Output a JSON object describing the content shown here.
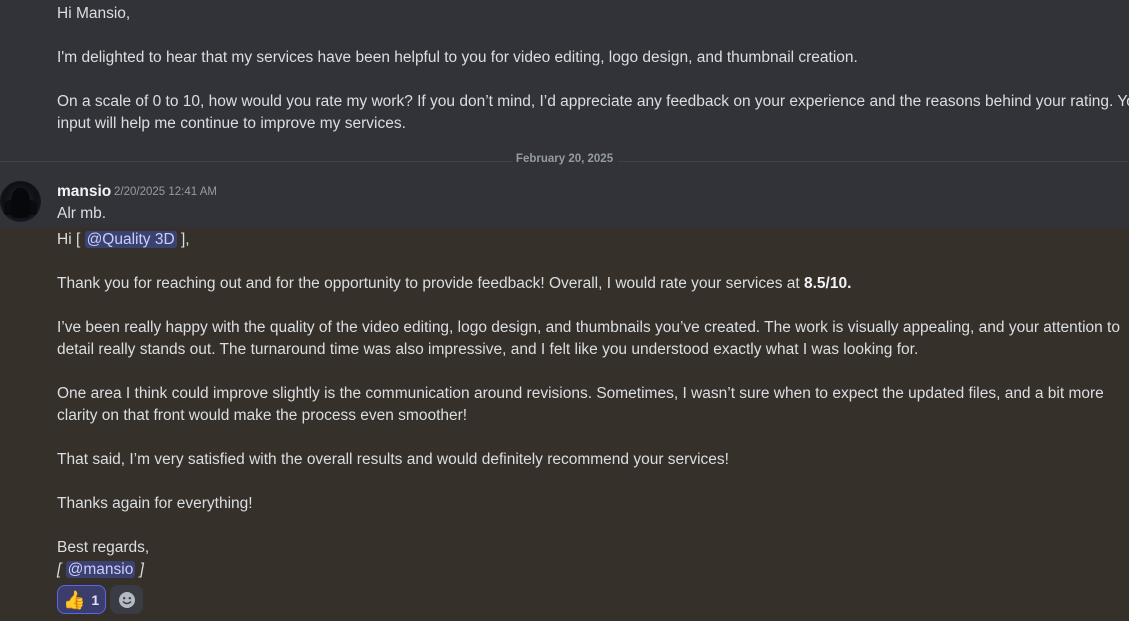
{
  "previous_message": {
    "lines": [
      "Hi Mansio,",
      "I'm delighted to hear that my services have been helpful to you for video editing, logo design, and thumbnail creation.",
      "On a scale of 0 to 10, how would you rate my work? If you don’t mind, I’d appreciate any feedback on your experience and the reasons behind your rating. Your",
      "input will help me continue to improve my services."
    ]
  },
  "divider": {
    "label": "February 20, 2025"
  },
  "message": {
    "username": "mansio",
    "timestamp": "2/20/2025 12:41 AM",
    "first_line": "Alr mb.",
    "greeting_prefix": "Hi [",
    "greeting_mention": "@Quality 3D",
    "greeting_suffix": "],",
    "rating_text": "Thank you for reaching out and for the opportunity to provide feedback! Overall, I would rate your services at",
    "rating_value": "8.5/10.",
    "para2_line1": "I’ve been really happy with the quality of the video editing, logo design, and thumbnails you’ve created. The work is visually appealing, and your attention to",
    "para2_line2": "detail really stands out. The turnaround time was also impressive, and I felt like you understood exactly what I was looking for.",
    "para3_line1": "One area I think could improve slightly is the communication around revisions. Sometimes, I wasn’t sure when to expect the updated files, and a bit more",
    "para3_line2": "clarity on that front would make the process even smoother!",
    "para4": "That said, I’m very satisfied with the overall results and would definitely recommend your services!",
    "thanks": "Thanks again for everything!",
    "regards": "Best regards,",
    "signature_prefix": "[",
    "signature_mention": "@mansio",
    "signature_suffix": "]"
  },
  "reactions": [
    {
      "emoji": "thumbs-up-icon",
      "count": "1"
    }
  ],
  "colors": {
    "background": "#323339",
    "highlight": "#35302a",
    "mention_bg": "#3c4270",
    "accent": "#5865f2"
  }
}
